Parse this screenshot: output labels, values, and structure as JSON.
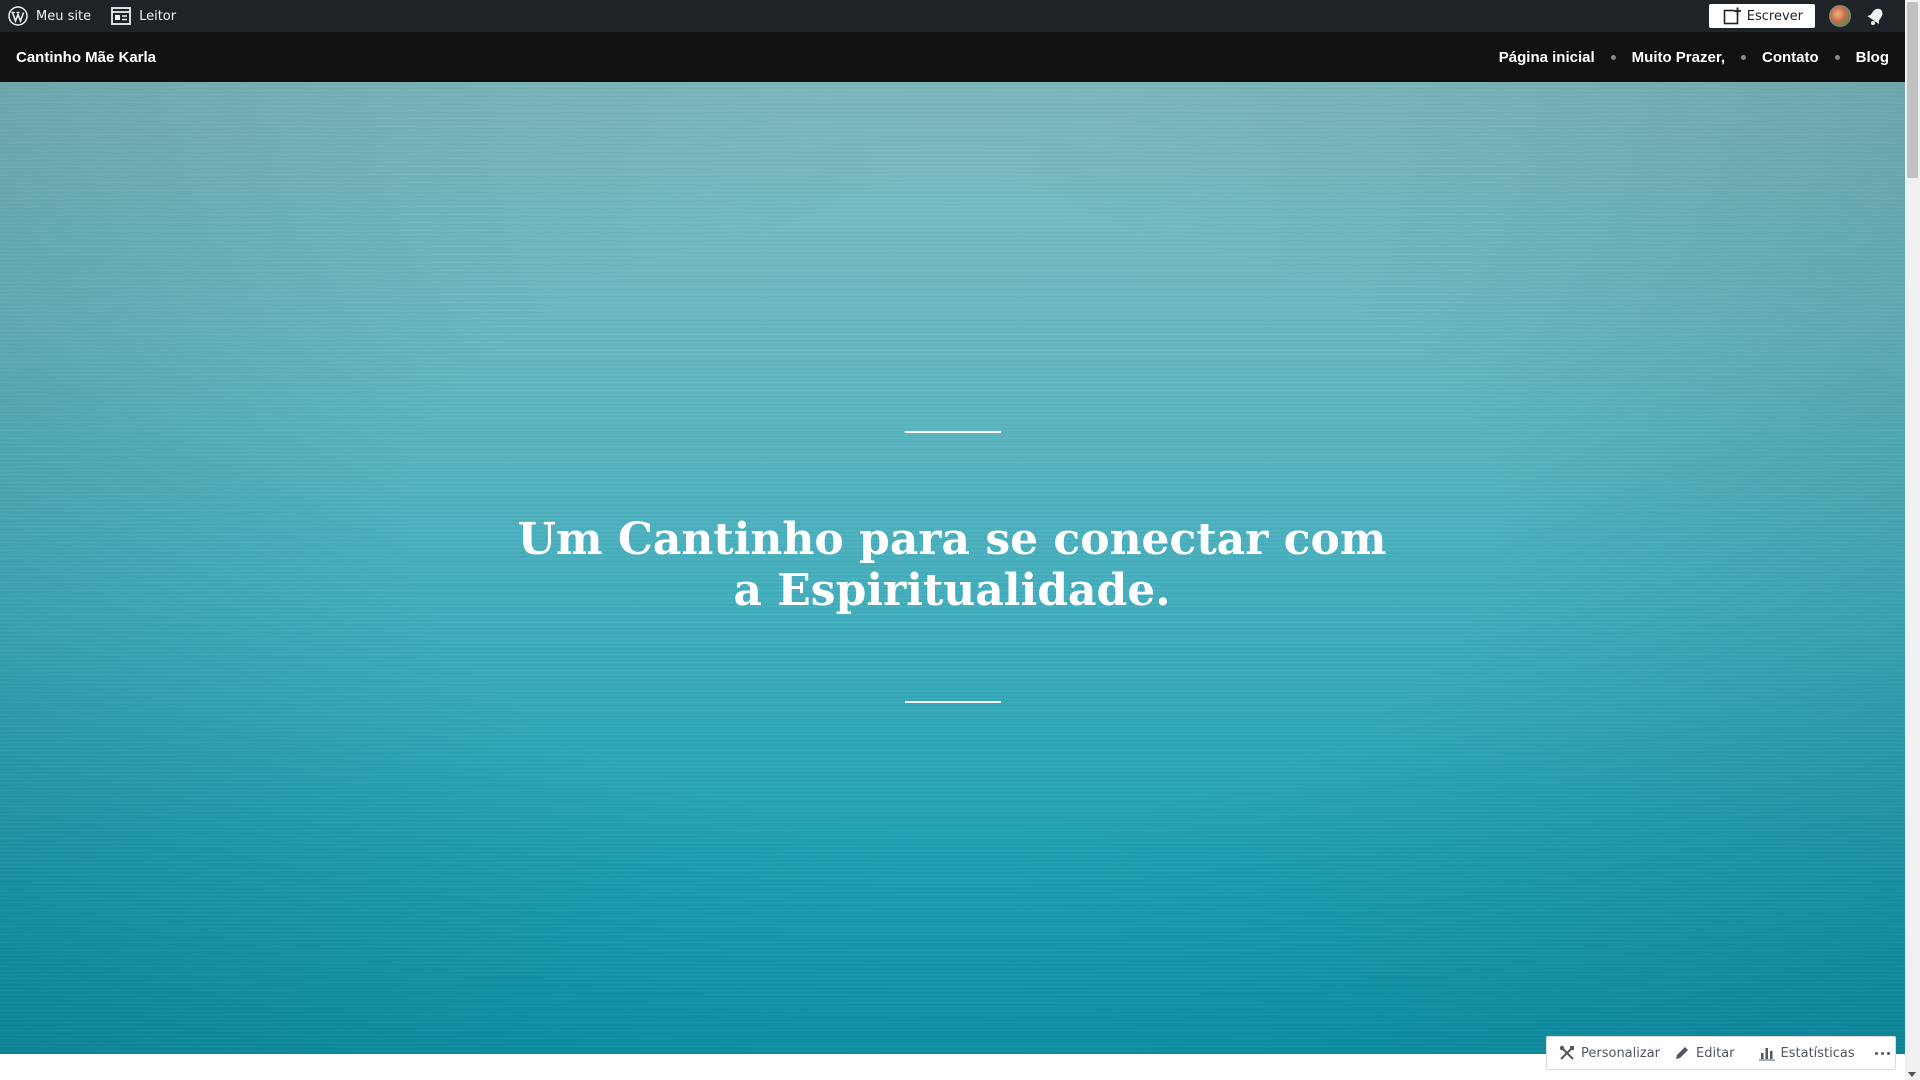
{
  "admin_bar": {
    "my_site": {
      "label": "Meu site",
      "icon": "wordpress-logo-icon"
    },
    "reader": {
      "label": "Leitor",
      "icon": "reader-icon"
    },
    "write": {
      "label": "Escrever",
      "icon": "write-post-icon"
    },
    "avatar": {
      "icon": "user-avatar"
    },
    "notifications": {
      "icon": "bell-icon"
    }
  },
  "site_header": {
    "title": "Cantinho Mãe Karla",
    "nav": [
      "Página inicial",
      "Muito Prazer,",
      "Contato",
      "Blog"
    ]
  },
  "hero": {
    "title_line1": "Um Cantinho para se conectar com",
    "title_line2": "a Espiritualidade."
  },
  "action_bar": {
    "customize": {
      "label": "Personalizar",
      "icon": "tools-icon"
    },
    "edit": {
      "label": "Editar",
      "icon": "pencil-icon"
    },
    "stats": {
      "label": "Estatísticas",
      "icon": "bar-chart-icon"
    },
    "more": {
      "icon": "ellipsis-icon"
    }
  },
  "colors": {
    "admin_bar_bg": "#1d2327",
    "header_bg": "#111111",
    "hero_top": "#82bfc3",
    "hero_bottom": "#0f98ae"
  }
}
